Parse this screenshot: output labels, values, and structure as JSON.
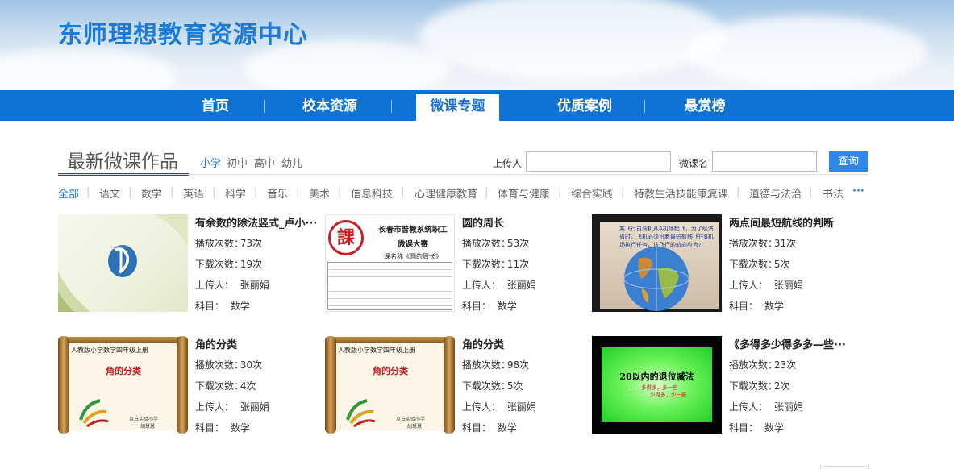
{
  "header": {
    "site_title": "东师理想教育资源中心"
  },
  "nav": {
    "items": [
      {
        "label": "首页"
      },
      {
        "label": "校本资源"
      },
      {
        "label": "微课专题",
        "active": true
      },
      {
        "label": "优质案例"
      },
      {
        "label": "悬赏榜"
      }
    ]
  },
  "section": {
    "title": "最新微课作品",
    "levels": [
      "小学",
      "初中",
      "高中",
      "幼儿"
    ],
    "active_level": "小学",
    "search": {
      "uploader_label": "上传人",
      "uploader_value": "",
      "course_label": "微课名",
      "course_value": "",
      "button_label": "查询"
    }
  },
  "subjects": {
    "items": [
      "全部",
      "语文",
      "数学",
      "英语",
      "科学",
      "音乐",
      "美术",
      "信息科技",
      "心理健康教育",
      "体育与健康",
      "综合实践",
      "特教生活技能康复课",
      "道德与法治",
      "书法"
    ],
    "active": "全部",
    "more": "···"
  },
  "labels": {
    "plays": "播放次数：",
    "downloads": "下载次数：",
    "uploader": "上传人：",
    "subject": "科目："
  },
  "cards": [
    {
      "title": "有余数的除法竖式_卢小···",
      "plays": "73次",
      "downloads": "19次",
      "uploader": "张丽娟",
      "subject": "数学",
      "thumb": "abstract-logo"
    },
    {
      "title": "圆的周长",
      "plays": "53次",
      "downloads": "11次",
      "uploader": "张丽娟",
      "subject": "数学",
      "thumb": "contest-doc",
      "thumb_text": {
        "l1": "长春市普教系统职工",
        "l2": "微课大赛",
        "l3": "课名称《圆的周长》",
        "logo": "課"
      }
    },
    {
      "title": "两点间最短航线的判断",
      "plays": "31次",
      "downloads": "5次",
      "uploader": "张丽娟",
      "subject": "数学",
      "thumb": "globe",
      "thumb_text": {
        "l1": "某飞行员驾机从A机场起飞，为了经济省时，飞机必须沿着最短航线飞往B机场执行任务，该飞行的航向应为?"
      }
    },
    {
      "title": "角的分类",
      "plays": "30次",
      "downloads": "4次",
      "uploader": "张丽娟",
      "subject": "数学",
      "thumb": "scroll",
      "thumb_text": {
        "l1": "人教版小学数学四年级上册",
        "l2": "角的分类",
        "l3": "京丘实验小学",
        "l4": "胡慧慧"
      }
    },
    {
      "title": "角的分类",
      "plays": "98次",
      "downloads": "5次",
      "uploader": "张丽娟",
      "subject": "数学",
      "thumb": "scroll",
      "thumb_text": {
        "l1": "人教版小学数学四年级上册",
        "l2": "角的分类",
        "l3": "京丘实验小学",
        "l4": "胡慧慧"
      }
    },
    {
      "title": "《多得多少得多多—些···",
      "plays": "23次",
      "downloads": "2次",
      "uploader": "张丽娟",
      "subject": "数学",
      "thumb": "green",
      "thumb_text": {
        "l1": "20以内的退位减法",
        "l2": "——多得多，多一些",
        "l3": "少得多，少一些"
      }
    }
  ],
  "colors": {
    "accent": "#0f73d6",
    "title_blue": "#1b7bd6",
    "button": "#2d88e8"
  }
}
